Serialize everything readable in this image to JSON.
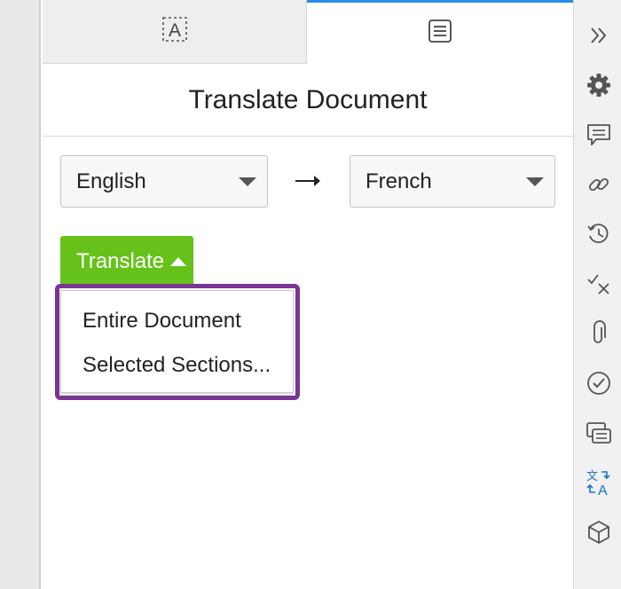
{
  "tabs": [
    {
      "name": "select-text-tab",
      "icon": "text-select-icon",
      "active": false
    },
    {
      "name": "document-tab",
      "icon": "document-icon",
      "active": true
    }
  ],
  "panel": {
    "title": "Translate Document",
    "source_language": "English",
    "target_language": "French",
    "translate_button_label": "Translate",
    "menu_items": [
      "Entire Document",
      "Selected Sections..."
    ]
  },
  "right_rail_icons": [
    "double-chevron-right-icon",
    "gear-icon",
    "comment-icon",
    "link-icon",
    "history-icon",
    "check-x-icon",
    "paperclip-icon",
    "check-circle-icon",
    "compare-list-icon",
    "translate-icon",
    "cube-icon"
  ],
  "colors": {
    "accent_tab": "#2b8de6",
    "translate_button": "#66c21b",
    "highlight_border": "#7b3594",
    "translate_icon_active": "#1a73c9"
  }
}
